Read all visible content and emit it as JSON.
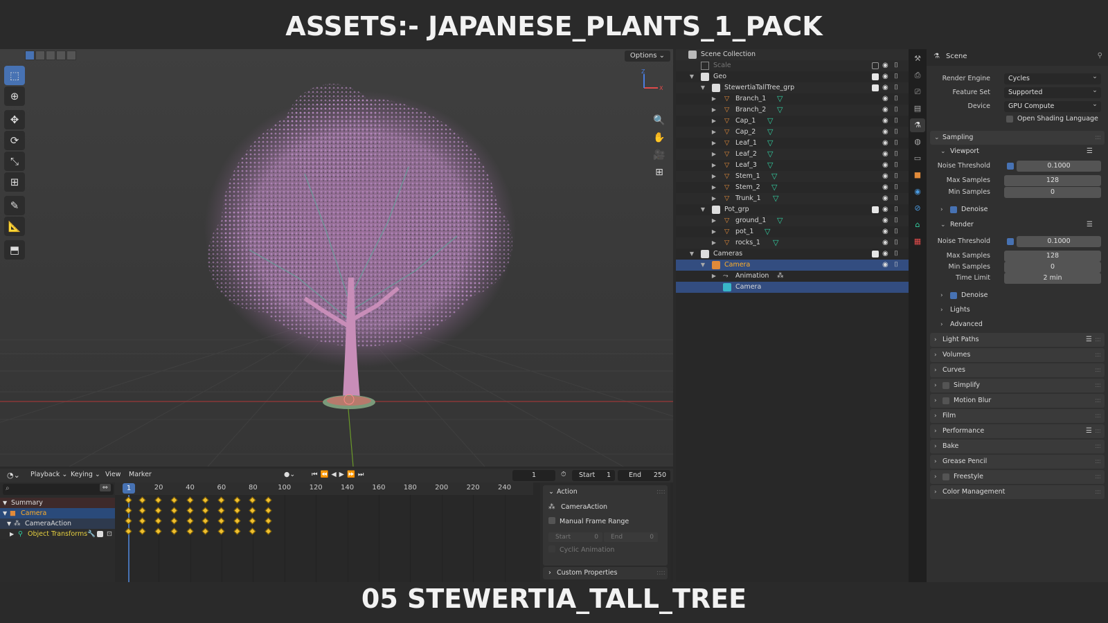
{
  "banner": {
    "title": "ASSETS:- JAPANESE_PLANTS_1_PACK",
    "subtitle": "05 STEWERTIA_TALL_TREE"
  },
  "viewport": {
    "options_label": "Options ⌄"
  },
  "outliner": {
    "root": "Scene Collection",
    "rows": [
      {
        "label": "Scale",
        "dim": true
      },
      {
        "label": "Geo"
      },
      {
        "label": "StewertiaTallTree_grp"
      },
      {
        "label": "Branch_1"
      },
      {
        "label": "Branch_2"
      },
      {
        "label": "Cap_1"
      },
      {
        "label": "Cap_2"
      },
      {
        "label": "Leaf_1"
      },
      {
        "label": "Leaf_2"
      },
      {
        "label": "Leaf_3"
      },
      {
        "label": "Stem_1"
      },
      {
        "label": "Stem_2"
      },
      {
        "label": "Trunk_1"
      },
      {
        "label": "Pot_grp"
      },
      {
        "label": "ground_1"
      },
      {
        "label": "pot_1"
      },
      {
        "label": "rocks_1"
      },
      {
        "label": "Cameras"
      },
      {
        "label": "Camera"
      },
      {
        "label": "Animation"
      },
      {
        "label": "Camera"
      }
    ]
  },
  "properties": {
    "header": "Scene",
    "render_engine": {
      "label": "Render Engine",
      "value": "Cycles"
    },
    "feature_set": {
      "label": "Feature Set",
      "value": "Supported"
    },
    "device": {
      "label": "Device",
      "value": "GPU Compute"
    },
    "osl": "Open Shading Language",
    "sampling": "Sampling",
    "viewport": {
      "title": "Viewport",
      "noise_threshold": {
        "label": "Noise Threshold",
        "value": "0.1000"
      },
      "max_samples": {
        "label": "Max Samples",
        "value": "128"
      },
      "min_samples": {
        "label": "Min Samples",
        "value": "0"
      },
      "denoise": "Denoise"
    },
    "render": {
      "title": "Render",
      "noise_threshold": {
        "label": "Noise Threshold",
        "value": "0.1000"
      },
      "max_samples": {
        "label": "Max Samples",
        "value": "128"
      },
      "min_samples": {
        "label": "Min Samples",
        "value": "0"
      },
      "time_limit": {
        "label": "Time Limit",
        "value": "2 min"
      },
      "denoise": "Denoise"
    },
    "lights": "Lights",
    "advanced": "Advanced",
    "panels": [
      "Light Paths",
      "Volumes",
      "Curves",
      "Simplify",
      "Motion Blur",
      "Film",
      "Performance",
      "Bake",
      "Grease Pencil",
      "Freestyle",
      "Color Management"
    ]
  },
  "timeline": {
    "menus": [
      "Playback ⌄",
      "Keying ⌄",
      "View",
      "Marker"
    ],
    "current_frame": "1",
    "start_label": "Start",
    "start_value": "1",
    "end_label": "End",
    "end_value": "250",
    "ruler_labels": [
      "20",
      "40",
      "60",
      "80",
      "100",
      "120",
      "140",
      "160",
      "180",
      "200",
      "220",
      "240"
    ],
    "playhead_label": "1",
    "channels": [
      {
        "label": "Summary"
      },
      {
        "label": "Camera"
      },
      {
        "label": "CameraAction"
      },
      {
        "label": "Object Transforms"
      }
    ],
    "key_frames": [
      1,
      10,
      20,
      30,
      40,
      50,
      60,
      70,
      80,
      90
    ]
  },
  "action_panel": {
    "title": "Action",
    "action_name": "CameraAction",
    "manual_frame_range": "Manual Frame Range",
    "start_label": "Start",
    "start_value": "0",
    "end_label": "End",
    "end_value": "0",
    "cyclic": "Cyclic Animation",
    "custom_props": "Custom Properties"
  }
}
